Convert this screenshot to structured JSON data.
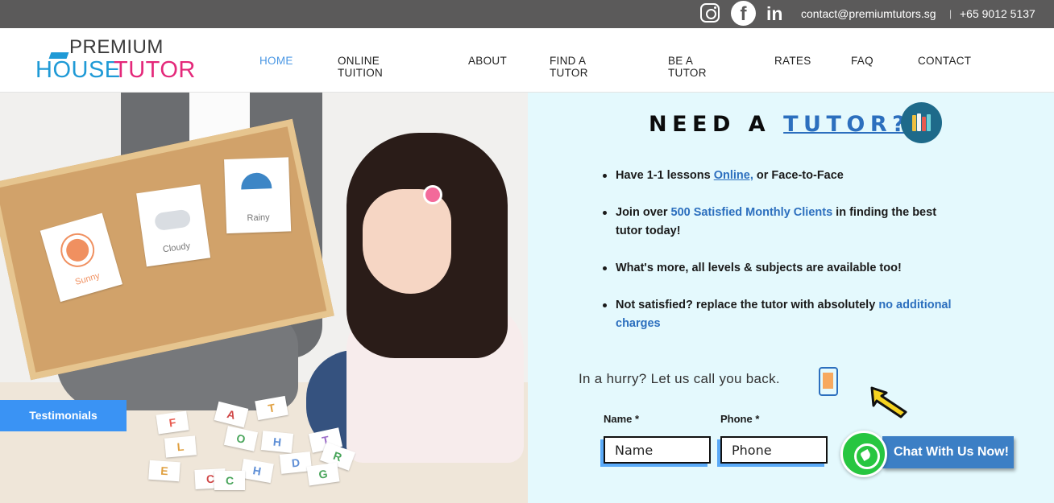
{
  "topbar": {
    "email": "contact@premiumtutors.sg",
    "separator": "|",
    "phone": "+65 9012 5137",
    "social_icons": [
      "instagram-icon",
      "facebook-icon",
      "linkedin-icon"
    ]
  },
  "logo": {
    "line1": "PREMIUM",
    "line2a": "HOUSE",
    "line2b": "TUTOR"
  },
  "nav": {
    "items": [
      {
        "label": "HOME",
        "active": true
      },
      {
        "label": "ONLINE TUITION"
      },
      {
        "label": "ABOUT"
      },
      {
        "label": "FIND A TUTOR"
      },
      {
        "label": "BE A TUTOR"
      },
      {
        "label": "RATES"
      },
      {
        "label": "FAQ"
      },
      {
        "label": "CONTACT"
      }
    ]
  },
  "hero": {
    "cards": [
      "Sunny",
      "Cloudy",
      "Rainy"
    ],
    "letters": [
      "F",
      "A",
      "T",
      "L",
      "O",
      "H",
      "T",
      "E",
      "D",
      "R",
      "C",
      "H",
      "G",
      "C"
    ],
    "testimonials_label": "Testimonials"
  },
  "panel": {
    "headline_prefix": "NEED A",
    "headline_accent": "TUTOR?",
    "bullets": [
      {
        "a": "Have 1-1 lessons ",
        "link": "Online,",
        "b": " or Face-to-Face"
      },
      {
        "a": "Join over ",
        "blue": "500 Satisfied Monthly Clients",
        "b": " in finding the best tutor today!"
      },
      {
        "a": "What's more, all levels & subjects are available too!"
      },
      {
        "a": "Not satisfied? replace the tutor with absolutely ",
        "blue": "no additional charges"
      }
    ],
    "hurry_text": "In a hurry? Let us call you back.",
    "name_label": "Name *",
    "name_placeholder": "Name",
    "phone_label": "Phone *",
    "phone_placeholder": "Phone"
  },
  "whatsapp": {
    "label": "Chat With Us Now!"
  },
  "colors": {
    "topbar": "#5b5a5a",
    "accent_blue": "#2c6fbe",
    "nav_active": "#4a97e4",
    "panel_bg": "#e4f9fd",
    "logo_blue": "#1f9ad6",
    "logo_pink": "#e4287a",
    "whatsapp_green": "#27c640"
  }
}
